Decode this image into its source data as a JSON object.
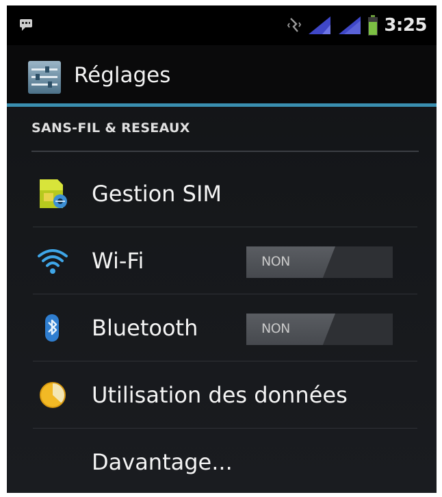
{
  "status_bar": {
    "time": "3:25",
    "icons": [
      "chat-notification-icon",
      "vibrate-icon",
      "signal-1-icon",
      "signal-2-icon",
      "battery-icon"
    ]
  },
  "action_bar": {
    "title": "Réglages",
    "accent_color": "#3a8fb0"
  },
  "section": {
    "header": "SANS-FIL & RESEAUX"
  },
  "rows": [
    {
      "label": "Gestion SIM",
      "icon": "sim-card-icon"
    },
    {
      "label": "Wi-Fi",
      "icon": "wifi-icon",
      "toggle": "NON"
    },
    {
      "label": "Bluetooth",
      "icon": "bluetooth-icon",
      "toggle": "NON"
    },
    {
      "label": "Utilisation des données",
      "icon": "data-usage-icon"
    },
    {
      "label": "Davantage..."
    }
  ]
}
